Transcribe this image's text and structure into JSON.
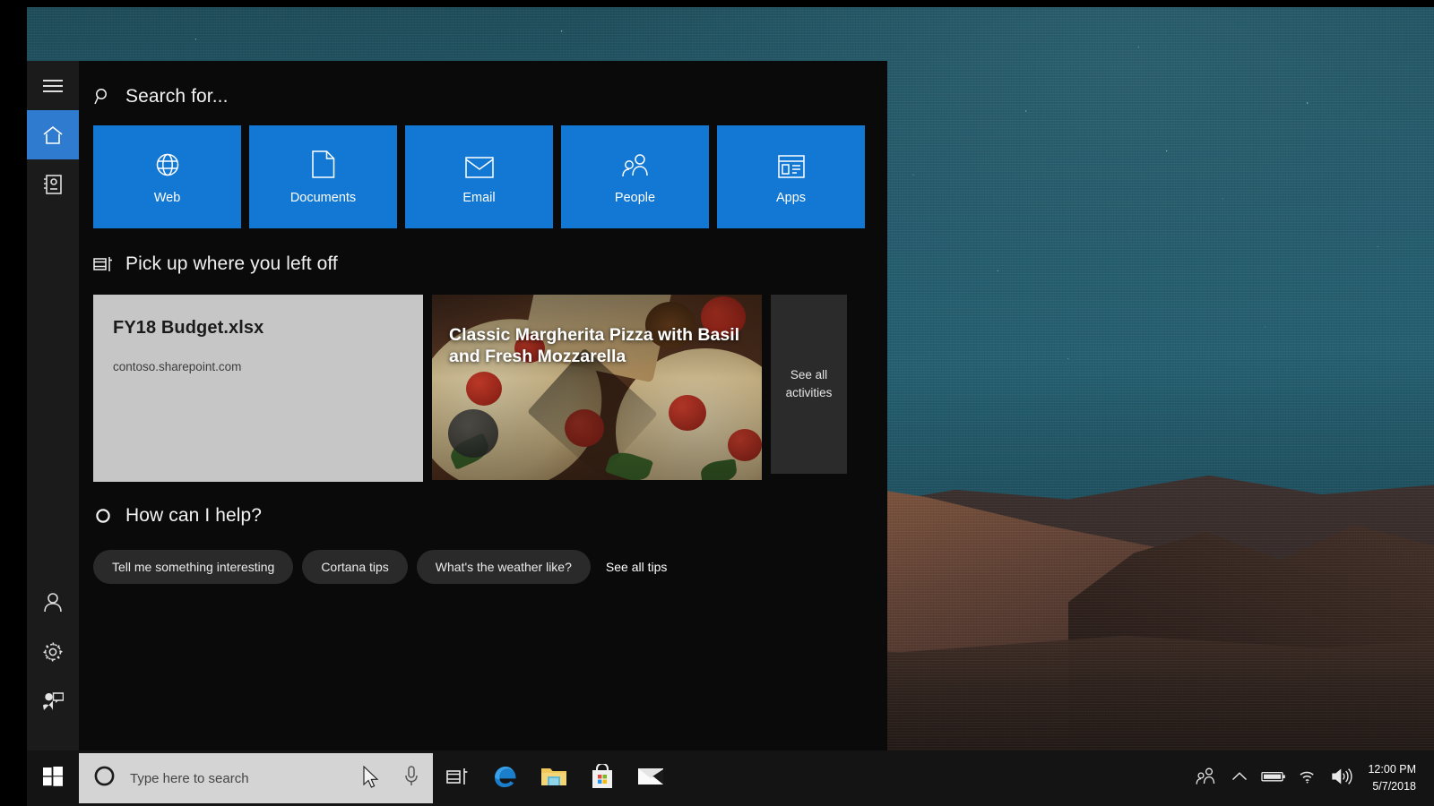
{
  "colors": {
    "panel_bg": "#0a0a0a",
    "rail_bg": "#1b1b1b",
    "tile_blue": "#1278d4",
    "accent_active": "#2e7bd0",
    "doc_card_bg": "#c6c6c6",
    "see_all_bg": "#2b2b2b",
    "chip_bg": "#2a2a2a",
    "taskbar_bg": "#141414",
    "searchbox_bg": "#d4d4d4"
  },
  "rail": {
    "top_items": [
      {
        "name": "hamburger-menu",
        "icon": "hamburger-icon",
        "active": false
      },
      {
        "name": "home",
        "icon": "home-icon",
        "active": true
      },
      {
        "name": "notebook",
        "icon": "notebook-icon",
        "active": false
      }
    ],
    "bottom_items": [
      {
        "name": "account",
        "icon": "person-icon",
        "active": false
      },
      {
        "name": "settings",
        "icon": "gear-icon",
        "active": false
      },
      {
        "name": "feedback",
        "icon": "feedback-icon",
        "active": false
      }
    ]
  },
  "search_header": {
    "icon": "search-icon",
    "label": "Search for..."
  },
  "tiles": [
    {
      "label": "Web",
      "icon": "globe-icon"
    },
    {
      "label": "Documents",
      "icon": "document-icon"
    },
    {
      "label": "Email",
      "icon": "envelope-icon"
    },
    {
      "label": "People",
      "icon": "people-icon"
    },
    {
      "label": "Apps",
      "icon": "app-window-icon"
    }
  ],
  "pickup": {
    "icon": "timeline-icon",
    "heading": "Pick up where you left off",
    "document_card": {
      "title": "FY18 Budget.xlsx",
      "source": "contoso.sharepoint.com"
    },
    "photo_card": {
      "title": "Classic Margherita Pizza with Basil and Fresh Mozzarella"
    },
    "see_all": "See all activities"
  },
  "help": {
    "icon": "cortana-circle-icon",
    "heading": "How can I help?",
    "chips": [
      "Tell me something interesting",
      "Cortana tips",
      "What's the weather like?"
    ],
    "see_all_tips": "See all tips"
  },
  "taskbar": {
    "start_icon": "windows-logo-icon",
    "search": {
      "cortana_icon": "cortana-circle-icon",
      "placeholder": "Type here to search",
      "value": "",
      "mic_icon": "microphone-icon"
    },
    "pinned": [
      {
        "name": "task-view",
        "icon": "task-view-icon"
      },
      {
        "name": "microsoft-edge",
        "icon": "edge-icon"
      },
      {
        "name": "file-explorer",
        "icon": "folder-icon"
      },
      {
        "name": "microsoft-store",
        "icon": "store-icon"
      },
      {
        "name": "mail",
        "icon": "mail-icon"
      }
    ],
    "tray": [
      {
        "name": "people-bar",
        "icon": "people-icon"
      },
      {
        "name": "show-hidden-icons",
        "icon": "chevron-up-icon"
      },
      {
        "name": "battery",
        "icon": "battery-icon"
      },
      {
        "name": "network",
        "icon": "wifi-icon"
      },
      {
        "name": "volume",
        "icon": "speaker-icon"
      }
    ],
    "clock": {
      "time": "12:00 PM",
      "date": "5/7/2018"
    }
  }
}
